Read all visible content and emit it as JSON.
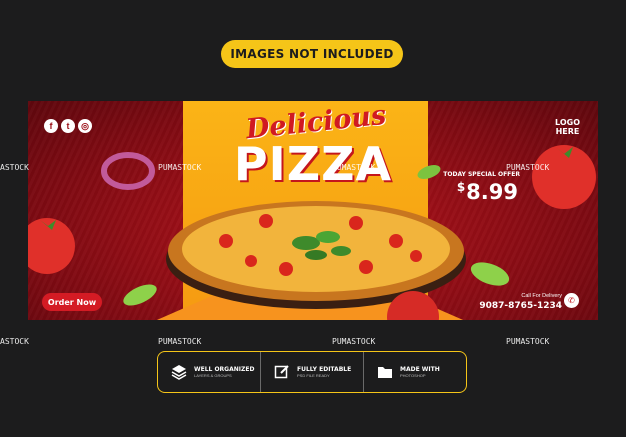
{
  "badge": {
    "label": "IMAGES NOT INCLUDED"
  },
  "banner": {
    "social_icons": [
      "facebook-icon",
      "twitter-icon",
      "instagram-icon"
    ],
    "social_glyphs": [
      "f",
      "t",
      "◎"
    ],
    "logo_line1": "LOGO",
    "logo_line2": "HERE",
    "headline_script": "Delicious",
    "headline_main": "PIZZA",
    "offer_label": "TODAY SPECIAL OFFER",
    "price_currency": "$",
    "price_value": "8.99",
    "order_button": "Order Now",
    "delivery_label": "Call For Delivery",
    "phone": "9087-8765-1234"
  },
  "watermark": {
    "text": "PUMASTOCK",
    "partial": "ASTOCK"
  },
  "features": [
    {
      "icon": "layers-icon",
      "title": "WELL ORGANIZED",
      "subtitle": "LAYERS & GROUPS"
    },
    {
      "icon": "edit-icon",
      "title": "FULLY EDITABLE",
      "subtitle": "PSD FILE READY"
    },
    {
      "icon": "folder-icon",
      "title": "MADE WITH",
      "subtitle": "PHOTOSHOP"
    }
  ],
  "colors": {
    "accent": "#f5c518",
    "brand_red": "#c4161c",
    "background": "#1c1c1d"
  }
}
